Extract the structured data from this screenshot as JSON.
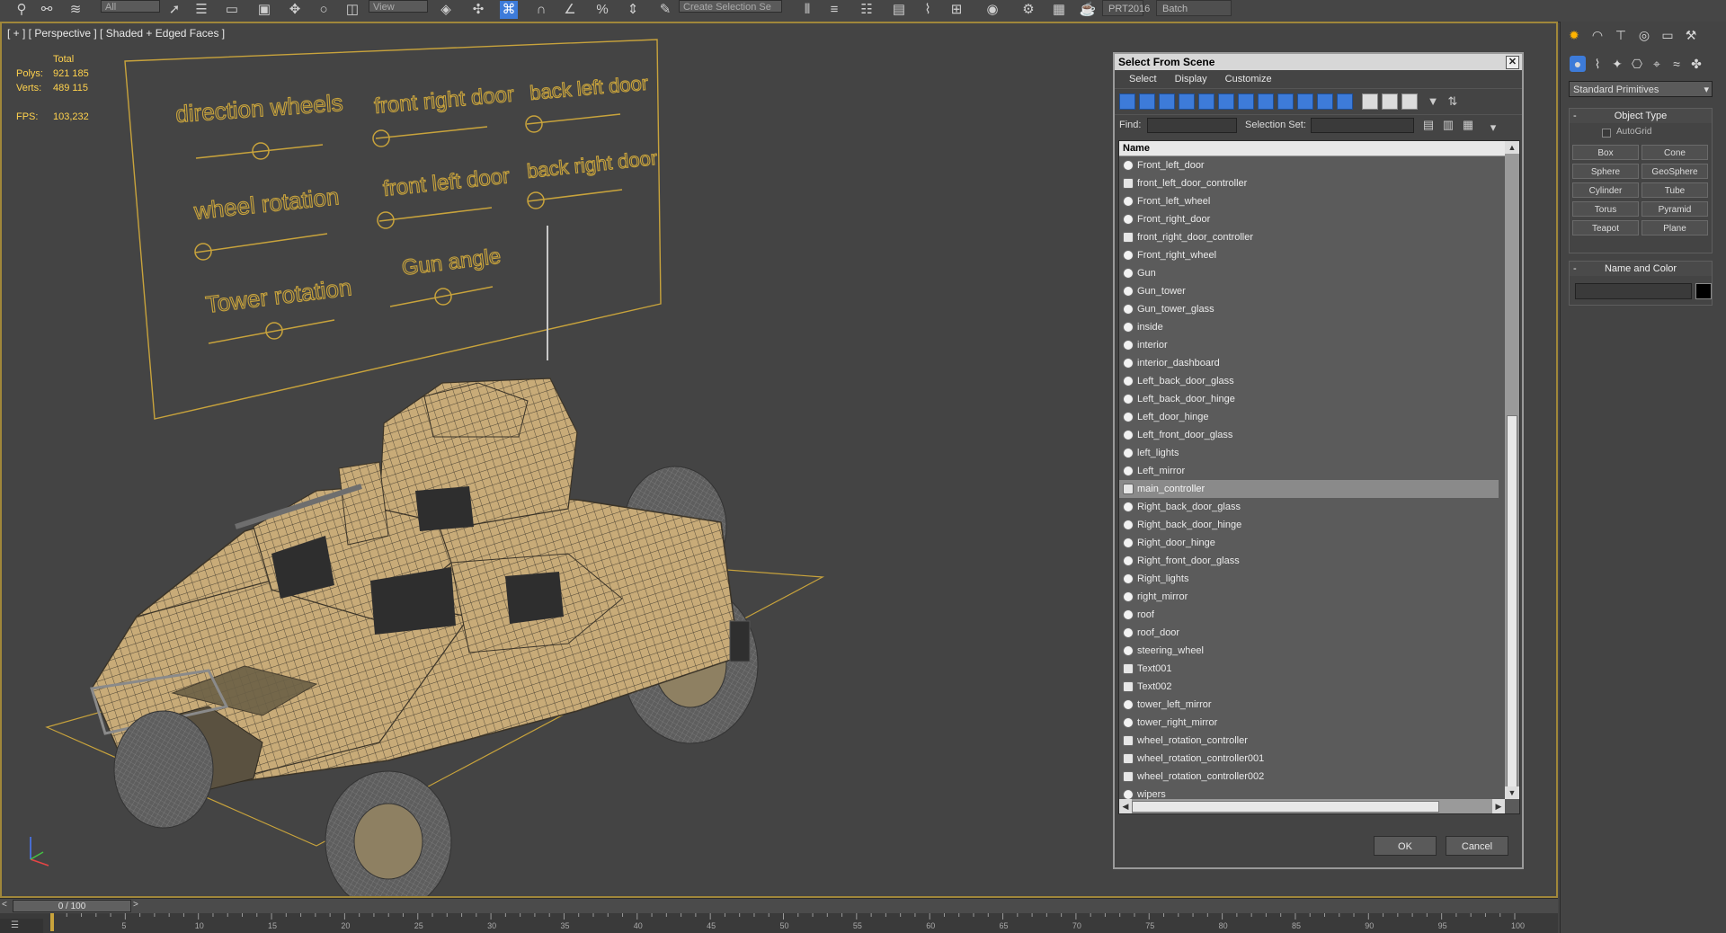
{
  "toolbar": {
    "selection_filter": "All",
    "view_dropdown": "View",
    "named_selection_placeholder": "Create Selection Se",
    "prt_label": "PRT2016",
    "batch_render_label": "Batch Render..."
  },
  "viewport": {
    "label": "[ + ] [ Perspective ] [ Shaded + Edged Faces ]",
    "stats": {
      "total_label": "Total",
      "polys_label": "Polys:",
      "polys_value": "921 185",
      "verts_label": "Verts:",
      "verts_value": "489 115",
      "fps_label": "FPS:",
      "fps_value": "103,232"
    },
    "control_panel_labels": {
      "direction_wheels": "direction wheels",
      "front_right_door": "front right door",
      "back_left_door": "back left door",
      "wheel_rotation": "wheel rotation",
      "front_left_door": "front left door",
      "back_right_door": "back right door",
      "tower_rotation": "Tower rotation",
      "gun_angle": "Gun angle"
    },
    "colors": {
      "wire_gold": "#c8a33c",
      "model_tan": "#c8ab78",
      "viewport_bg": "#444444"
    }
  },
  "dialog": {
    "title": "Select From Scene",
    "menu": [
      "Select",
      "Display",
      "Customize"
    ],
    "find_label": "Find:",
    "selection_set_label": "Selection Set:",
    "column_header": "Name",
    "ok_label": "OK",
    "cancel_label": "Cancel",
    "items": [
      {
        "name": "Front_left_door",
        "icon": "geometry-icon"
      },
      {
        "name": "front_left_door_controller",
        "icon": "shape-icon"
      },
      {
        "name": "Front_left_wheel",
        "icon": "geometry-icon"
      },
      {
        "name": "Front_right_door",
        "icon": "geometry-icon"
      },
      {
        "name": "front_right_door_controller",
        "icon": "shape-icon"
      },
      {
        "name": "Front_right_wheel",
        "icon": "geometry-icon"
      },
      {
        "name": "Gun",
        "icon": "geometry-icon"
      },
      {
        "name": "Gun_tower",
        "icon": "geometry-icon"
      },
      {
        "name": "Gun_tower_glass",
        "icon": "geometry-icon"
      },
      {
        "name": "inside",
        "icon": "geometry-icon"
      },
      {
        "name": "interior",
        "icon": "geometry-icon"
      },
      {
        "name": "interior_dashboard",
        "icon": "geometry-icon"
      },
      {
        "name": "Left_back_door_glass",
        "icon": "geometry-icon"
      },
      {
        "name": "Left_back_door_hinge",
        "icon": "geometry-icon"
      },
      {
        "name": "Left_door_hinge",
        "icon": "geometry-icon"
      },
      {
        "name": "Left_front_door_glass",
        "icon": "geometry-icon"
      },
      {
        "name": "left_lights",
        "icon": "geometry-icon"
      },
      {
        "name": "Left_mirror",
        "icon": "geometry-icon"
      },
      {
        "name": "main_controller",
        "icon": "shape-icon",
        "selected": true
      },
      {
        "name": "Right_back_door_glass",
        "icon": "geometry-icon"
      },
      {
        "name": "Right_back_door_hinge",
        "icon": "geometry-icon"
      },
      {
        "name": "Right_door_hinge",
        "icon": "geometry-icon"
      },
      {
        "name": "Right_front_door_glass",
        "icon": "geometry-icon"
      },
      {
        "name": "Right_lights",
        "icon": "geometry-icon"
      },
      {
        "name": "right_mirror",
        "icon": "geometry-icon"
      },
      {
        "name": "roof",
        "icon": "geometry-icon"
      },
      {
        "name": "roof_door",
        "icon": "geometry-icon"
      },
      {
        "name": "steering_wheel",
        "icon": "geometry-icon"
      },
      {
        "name": "Text001",
        "icon": "shape-icon"
      },
      {
        "name": "Text002",
        "icon": "shape-icon"
      },
      {
        "name": "tower_left_mirror",
        "icon": "geometry-icon"
      },
      {
        "name": "tower_right_mirror",
        "icon": "geometry-icon"
      },
      {
        "name": "wheel_rotation_controller",
        "icon": "shape-icon"
      },
      {
        "name": "wheel_rotation_controller001",
        "icon": "shape-icon"
      },
      {
        "name": "wheel_rotation_controller002",
        "icon": "shape-icon"
      },
      {
        "name": "wipers",
        "icon": "geometry-icon"
      }
    ]
  },
  "command_panel": {
    "category_dropdown": "Standard Primitives",
    "object_type_title": "Object Type",
    "autogrid_label": "AutoGrid",
    "primitives": [
      "Box",
      "Cone",
      "Sphere",
      "GeoSphere",
      "Cylinder",
      "Tube",
      "Torus",
      "Pyramid",
      "Teapot",
      "Plane"
    ],
    "name_color_title": "Name and Color",
    "name_value": "",
    "object_color": "#000000"
  },
  "timeline": {
    "frame_readout": "0 / 100",
    "tick_labels": [
      "5",
      "10",
      "15",
      "20",
      "25",
      "30",
      "35",
      "40",
      "45",
      "50",
      "55",
      "60",
      "65",
      "70",
      "75",
      "80",
      "85",
      "90",
      "95",
      "100"
    ]
  }
}
